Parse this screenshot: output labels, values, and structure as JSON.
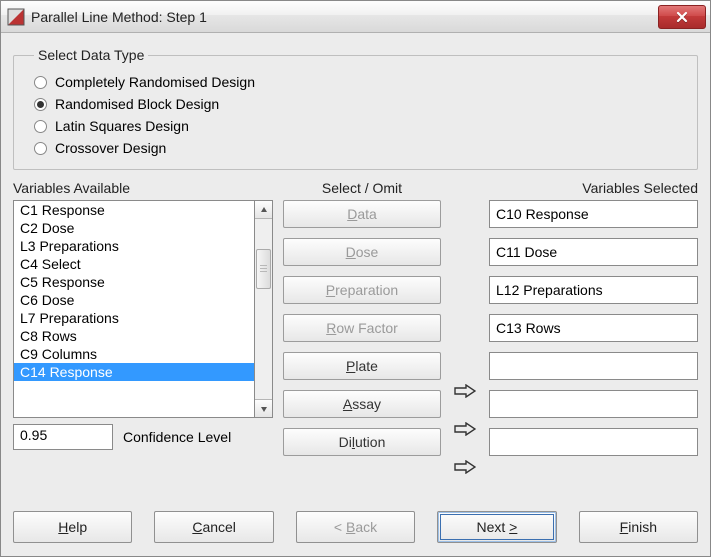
{
  "window": {
    "title": "Parallel Line Method: Step 1"
  },
  "group": {
    "legend": "Select Data Type",
    "options": [
      {
        "label": "Completely Randomised Design",
        "checked": false
      },
      {
        "label": "Randomised Block Design",
        "checked": true
      },
      {
        "label": "Latin Squares Design",
        "checked": false
      },
      {
        "label": "Crossover Design",
        "checked": false
      }
    ]
  },
  "labels": {
    "available": "Variables Available",
    "select_omit": "Select / Omit",
    "selected": "Variables Selected",
    "confidence": "Confidence Level"
  },
  "available": [
    "C1 Response",
    "C2 Dose",
    "L3 Preparations",
    "C4 Select",
    "C5 Response",
    "C6 Dose",
    "L7 Preparations",
    "C8 Rows",
    "C9 Columns",
    "C14 Response"
  ],
  "available_selected_index": 9,
  "mid_buttons": [
    {
      "key": "data",
      "label": "Data",
      "ul": 0,
      "disabled": true
    },
    {
      "key": "dose",
      "label": "Dose",
      "ul": 0,
      "disabled": true
    },
    {
      "key": "preparation",
      "label": "Preparation",
      "ul": 0,
      "disabled": true
    },
    {
      "key": "rowfactor",
      "label": "Row Factor",
      "ul": 0,
      "disabled": true
    },
    {
      "key": "plate",
      "label": "Plate",
      "ul": 0,
      "disabled": false
    },
    {
      "key": "assay",
      "label": "Assay",
      "ul": 0,
      "disabled": false
    },
    {
      "key": "dilution",
      "label": "Dilution",
      "ul": 2,
      "disabled": false
    }
  ],
  "selected_fields": [
    "C10 Response",
    "C11 Dose",
    "L12 Preparations",
    "C13 Rows",
    "",
    "",
    ""
  ],
  "confidence_value": "0.95",
  "footer": {
    "help": "Help",
    "cancel": "Cancel",
    "back": "< Back",
    "next": "Next >",
    "finish": "Finish"
  }
}
